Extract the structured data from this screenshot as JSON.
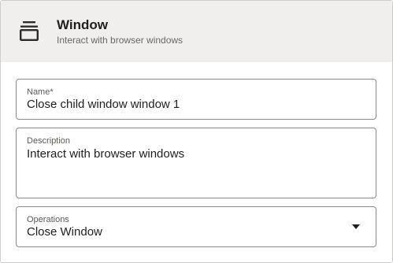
{
  "header": {
    "icon": "window-stack-icon",
    "title": "Window",
    "subtitle": "Interact with browser windows"
  },
  "fields": {
    "name": {
      "label": "Name*",
      "value": "Close child window window 1"
    },
    "description": {
      "label": "Description",
      "value": "Interact with browser windows"
    },
    "operations": {
      "label": "Operations",
      "value": "Close Window",
      "icon": "chevron-down-icon"
    }
  },
  "colors": {
    "header_bg": "#f1efed",
    "border": "#8e8b86",
    "text": "#1f1f1f",
    "muted": "#6b6863"
  }
}
